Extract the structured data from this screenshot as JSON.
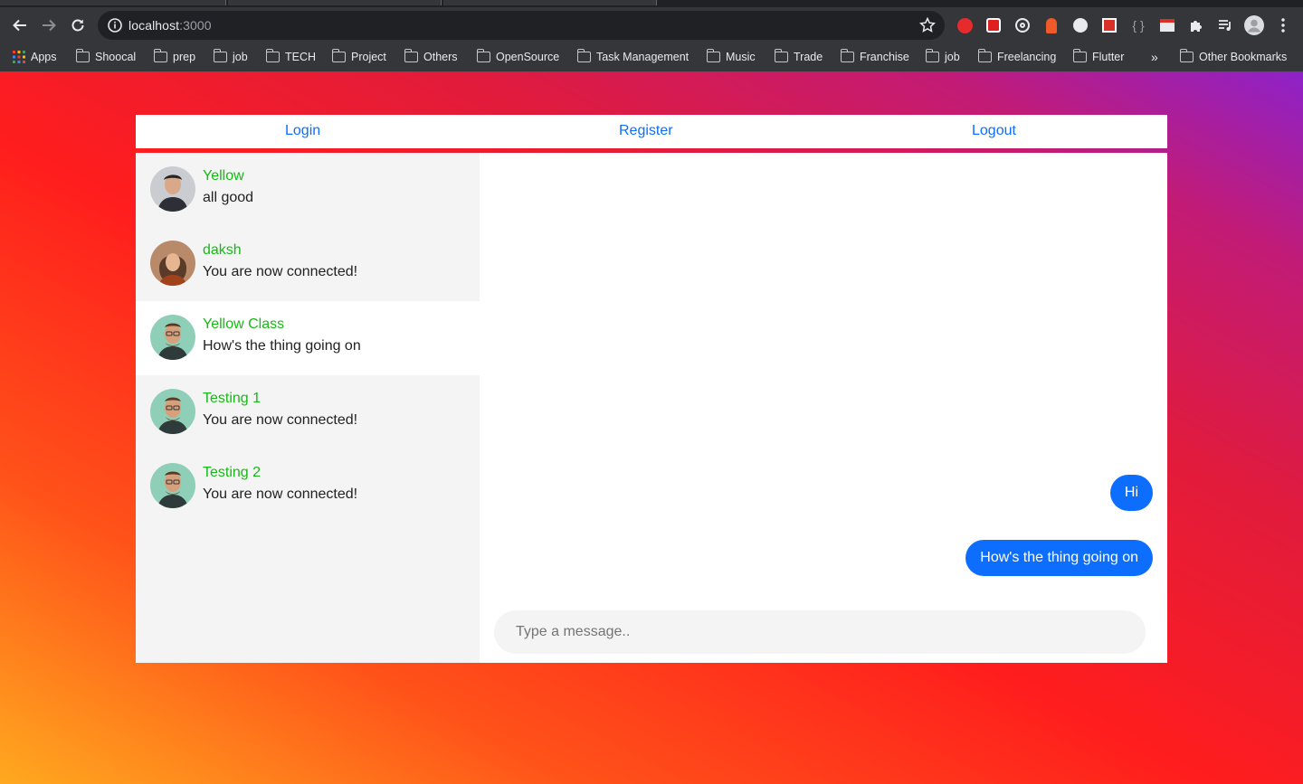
{
  "browser": {
    "url_host": "localhost",
    "url_port": ":3000",
    "bookmarks": [
      {
        "label": "Apps",
        "icon": "apps-grid-icon"
      },
      {
        "label": "Shoocal",
        "icon": "folder-icon"
      },
      {
        "label": "prep",
        "icon": "folder-icon"
      },
      {
        "label": "job",
        "icon": "folder-icon"
      },
      {
        "label": "TECH",
        "icon": "folder-icon"
      },
      {
        "label": "Project",
        "icon": "folder-icon"
      },
      {
        "label": "Others",
        "icon": "folder-icon"
      },
      {
        "label": "OpenSource",
        "icon": "folder-icon"
      },
      {
        "label": "Task Management",
        "icon": "folder-icon"
      },
      {
        "label": "Music",
        "icon": "folder-icon"
      },
      {
        "label": "Trade",
        "icon": "folder-icon"
      },
      {
        "label": "Franchise",
        "icon": "folder-icon"
      },
      {
        "label": "job",
        "icon": "folder-icon"
      },
      {
        "label": "Freelancing",
        "icon": "folder-icon"
      },
      {
        "label": "Flutter",
        "icon": "folder-icon"
      }
    ],
    "overflow_label": "»",
    "other_bookmarks": "Other Bookmarks"
  },
  "nav": {
    "login": "Login",
    "register": "Register",
    "logout": "Logout"
  },
  "contacts": [
    {
      "name": "Yellow",
      "last_message": "all good",
      "active": false
    },
    {
      "name": "daksh",
      "last_message": "You are now connected!",
      "active": false
    },
    {
      "name": "Yellow Class",
      "last_message": "How's the thing going on",
      "active": true
    },
    {
      "name": "Testing 1",
      "last_message": "You are now connected!",
      "active": false
    },
    {
      "name": "Testing 2",
      "last_message": "You are now connected!",
      "active": false
    }
  ],
  "messages": [
    {
      "text": "Hi",
      "from": "me"
    },
    {
      "text": "How's the thing going on",
      "from": "me"
    }
  ],
  "composer": {
    "placeholder": "Type a message.."
  },
  "colors": {
    "link": "#0d6efd",
    "bubble": "#0d6efd",
    "contact_name": "#18b818"
  }
}
